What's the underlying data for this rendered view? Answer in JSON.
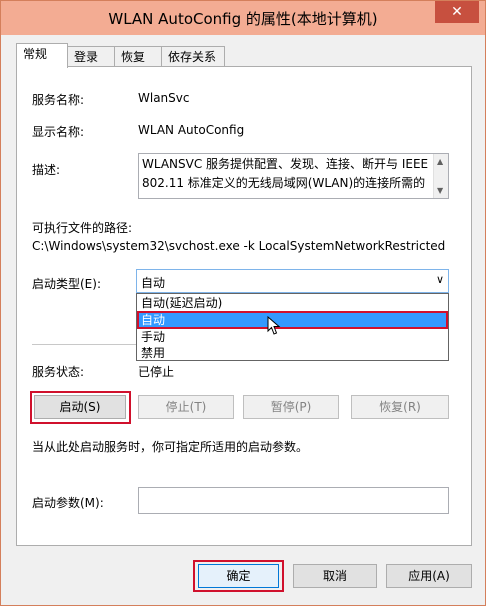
{
  "window": {
    "title": "WLAN AutoConfig 的属性(本地计算机)",
    "close_glyph": "✕"
  },
  "tabs": [
    {
      "label": "常规"
    },
    {
      "label": "登录"
    },
    {
      "label": "恢复"
    },
    {
      "label": "依存关系"
    }
  ],
  "general": {
    "service_name_label": "服务名称:",
    "service_name": "WlanSvc",
    "display_name_label": "显示名称:",
    "display_name": "WLAN AutoConfig",
    "description_label": "描述:",
    "description": "WLANSVC 服务提供配置、发现、连接、断开与 IEEE 802.11 标准定义的无线局域网(WLAN)的连接所需的",
    "exe_path_label": "可执行文件的路径:",
    "exe_path": "C:\\Windows\\system32\\svchost.exe -k LocalSystemNetworkRestricted",
    "startup_type_label": "启动类型(E):",
    "startup_type_value": "自动",
    "startup_options": [
      "自动(延迟启动)",
      "自动",
      "手动",
      "禁用"
    ],
    "service_status_label": "服务状态:",
    "service_status": "已停止",
    "hint": "当从此处启动服务时，你可指定所适用的启动参数。",
    "start_params_label": "启动参数(M):"
  },
  "buttons": {
    "start": "启动(S)",
    "stop": "停止(T)",
    "pause": "暂停(P)",
    "resume": "恢复(R)",
    "ok": "确定",
    "cancel": "取消",
    "apply": "应用(A)"
  }
}
